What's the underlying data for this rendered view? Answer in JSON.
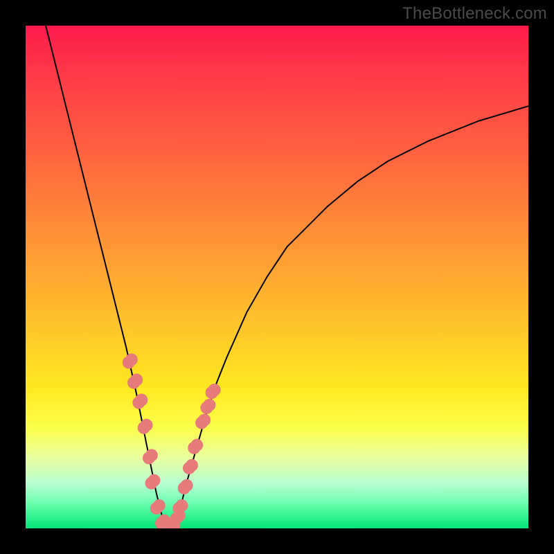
{
  "watermark": "TheBottleneck.com",
  "chart_data": {
    "type": "line",
    "title": "",
    "xlabel": "",
    "ylabel": "",
    "xlim": [
      0,
      100
    ],
    "ylim": [
      0,
      100
    ],
    "grid": false,
    "legend": false,
    "series": [
      {
        "name": "bottleneck-curve",
        "color": "#000000",
        "x": [
          4,
          6,
          8,
          10,
          12,
          14,
          16,
          18,
          20,
          22,
          23,
          24,
          25,
          26,
          27,
          28,
          29,
          30,
          31,
          32,
          34,
          36,
          38,
          40,
          44,
          48,
          52,
          56,
          60,
          66,
          72,
          80,
          90,
          100
        ],
        "y": [
          100,
          92,
          84,
          76,
          68,
          60,
          52,
          44,
          36,
          27,
          22,
          17,
          12,
          7,
          3,
          0,
          0,
          2,
          5,
          9,
          16,
          23,
          29,
          34,
          43,
          50,
          56,
          60,
          64,
          69,
          73,
          77,
          81,
          84
        ]
      }
    ],
    "markers": {
      "name": "highlight-dots",
      "color": "#e77a7a",
      "radius": 9,
      "x": [
        20.5,
        21.5,
        22.5,
        23.5,
        24.5,
        25.0,
        26.0,
        27.0,
        28.0,
        29.0,
        30.0,
        30.5,
        31.5,
        32.5,
        33.5,
        35.0,
        36.0,
        37.0
      ],
      "y": [
        33,
        29,
        25,
        20,
        14,
        9,
        4,
        1,
        0,
        0,
        2,
        4,
        8,
        12,
        16,
        21,
        24,
        27
      ]
    },
    "annotations": []
  }
}
